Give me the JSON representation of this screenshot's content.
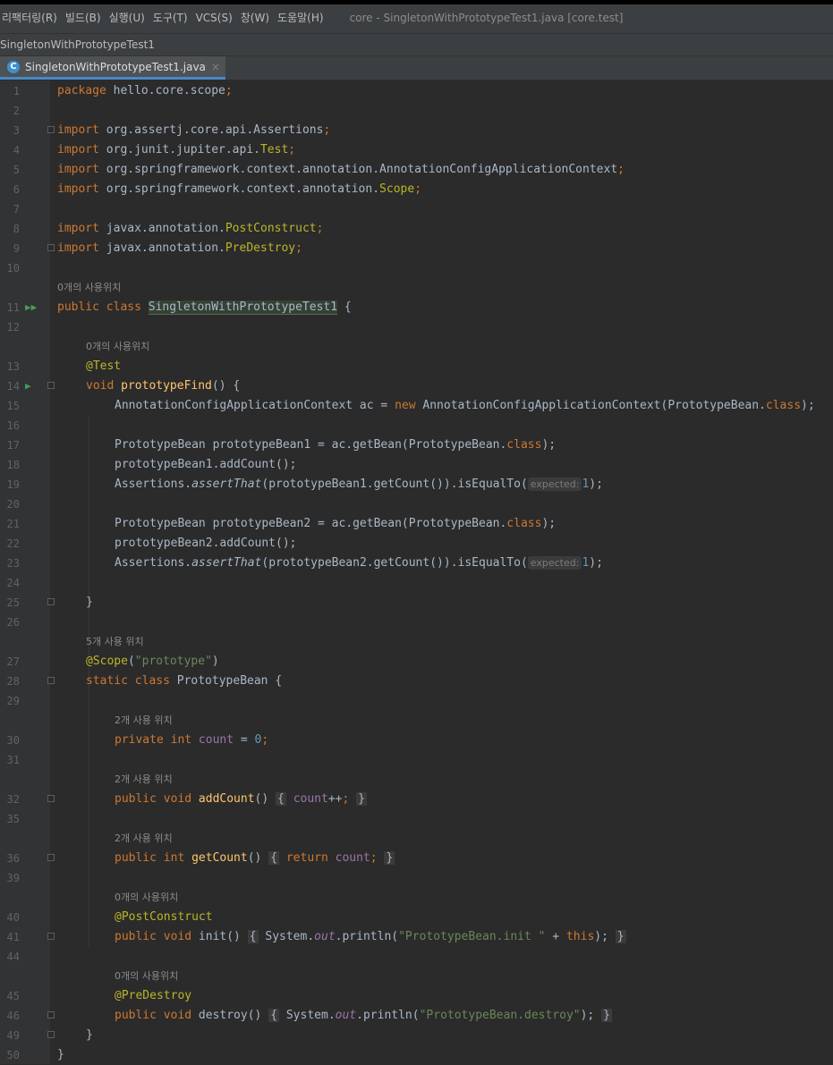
{
  "menu": {
    "items": [
      "리팩터링(R)",
      "빌드(B)",
      "실행(U)",
      "도구(T)",
      "VCS(S)",
      "창(W)",
      "도움말(H)"
    ],
    "title": "core - SingletonWithPrototypeTest1.java [core.test]"
  },
  "breadcrumb": "SingletonWithPrototypeTest1",
  "tab": {
    "icon_letter": "C",
    "label": "SingletonWithPrototypeTest1.java",
    "close": "×"
  },
  "usages": {
    "zero": "0개의 사용위치",
    "five": "5개 사용 위치",
    "two": "2개 사용 위치"
  },
  "hint_expected": "expected:",
  "line_numbers": [
    "1",
    "2",
    "3",
    "4",
    "5",
    "6",
    "7",
    "8",
    "9",
    "10",
    "11",
    "12",
    "13",
    "14",
    "15",
    "16",
    "17",
    "18",
    "19",
    "20",
    "21",
    "22",
    "23",
    "24",
    "25",
    "26",
    "27",
    "28",
    "29",
    "30",
    "31",
    "32",
    "35",
    "36",
    "39",
    "40",
    "41",
    "44",
    "45",
    "46",
    "49",
    "50"
  ],
  "code": {
    "l1_pkg": "package",
    "l1_rest": " hello.core.scope",
    "l3_imp": "import",
    "l3_rest": " org.assertj.core.api.Assertions",
    "l4_rest": " org.junit.jupiter.api.",
    "l4_cls": "Test",
    "l5_rest": " org.springframework.context.annotation.AnnotationConfigApplicationContext",
    "l6_rest": " org.springframework.context.annotation.",
    "l6_cls": "Scope",
    "l8_rest": " javax.annotation.",
    "l8_cls": "PostConstruct",
    "l9_cls": "PreDestroy",
    "l11_kw": "public class ",
    "l11_cls": "SingletonWithPrototypeTest1",
    "l11_rest": " {",
    "l13_ann": "@Test",
    "l14_kw": "void ",
    "l14_meth": "prototypeFind",
    "l14_rest": "() {",
    "l15_a": "AnnotationConfigApplicationContext ac = ",
    "l15_new": "new",
    "l15_b": " AnnotationConfigApplicationContext(PrototypeBean.",
    "l15_class": "class",
    "l15_c": ");",
    "l17_a": "PrototypeBean prototypeBean1 = ac.getBean(PrototypeBean.",
    "l17_class": "class",
    "l17_c": ");",
    "l18": "prototypeBean1.addCount();",
    "l19_a": "Assertions.",
    "l19_it": "assertThat",
    "l19_b": "(prototypeBean1.getCount()).isEqualTo(",
    "l19_num": "1",
    "l19_c": ");",
    "l21_a": "PrototypeBean prototypeBean2 = ac.getBean(PrototypeBean.",
    "l22": "prototypeBean2.addCount();",
    "l23_b": "(prototypeBean2.getCount()).isEqualTo(",
    "l25": "}",
    "l27_ann": "@Scope",
    "l27_str": "\"prototype\"",
    "l28_kw": "static class ",
    "l28_rest": "PrototypeBean {",
    "l30_kw": "private int ",
    "l30_fld": "count",
    "l30_eq": " = ",
    "l30_num": "0",
    "l30_semi": ";",
    "l32_kw": "public void ",
    "l32_meth": "addCount",
    "l32_b": "() ",
    "l32_body_fld": "count",
    "l32_body_op": "++",
    "l36_kw": "public int ",
    "l36_meth": "getCount",
    "l36_ret": "return ",
    "l40_ann": "@PostConstruct",
    "l41_kw": "public void ",
    "l41_meth": "init",
    "l41_sys": "System.",
    "l41_out": "out",
    "l41_println": ".println(",
    "l41_str": "\"PrototypeBean.init \"",
    "l41_plus": " + ",
    "l41_this": "this",
    "l41_end": ");",
    "l45_ann": "@PreDestroy",
    "l46_meth": "destroy",
    "l46_str": "\"PrototypeBean.destroy\"",
    "l46_end": ");",
    "l49": "}",
    "l50": "}"
  },
  "colors": {
    "keyword": "#cc7832",
    "annotation": "#bbb529",
    "string": "#6a8759",
    "number": "#6897bb",
    "field": "#9876aa",
    "method": "#ffc66d",
    "text": "#a9b7c6",
    "background": "#2b2b2b"
  }
}
